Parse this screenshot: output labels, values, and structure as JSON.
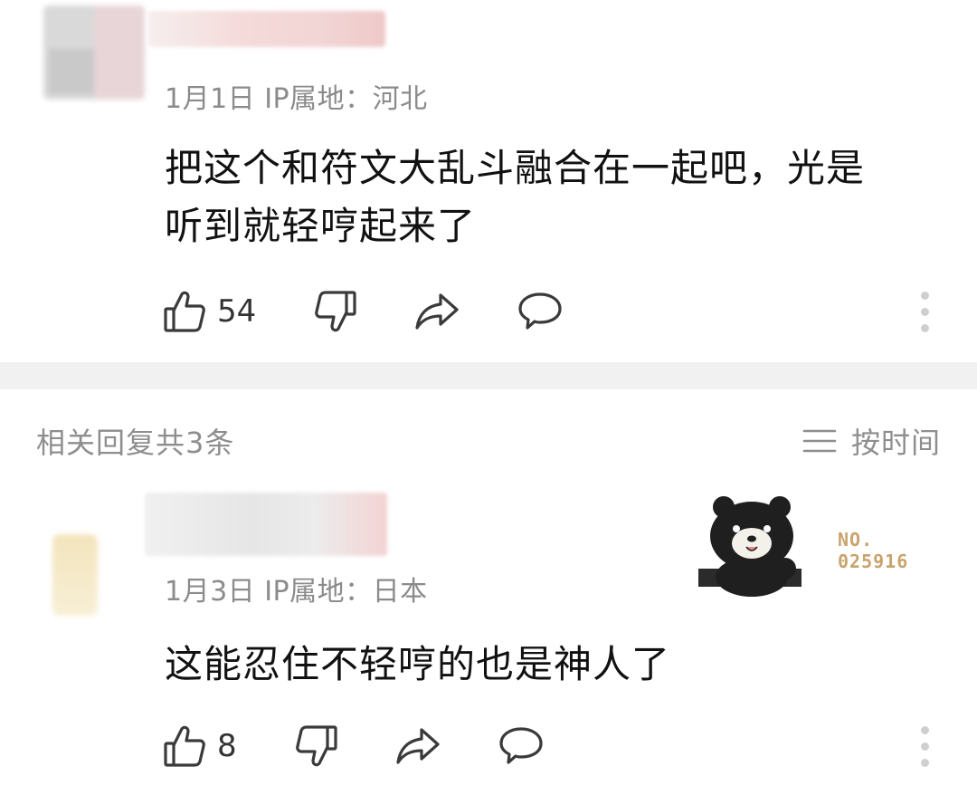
{
  "comments": [
    {
      "meta": "1月1日 IP属地：河北",
      "text_lines": [
        "把这个和符文大乱斗融合在一起吧，光是",
        "听到就轻哼起来了"
      ],
      "likes": "54"
    },
    {
      "meta": "1月3日 IP属地：日本",
      "text_lines": [
        "这能忍住不轻哼的也是神人了"
      ],
      "likes": "8",
      "badge": {
        "line1": "NO.",
        "line2": "025916"
      }
    }
  ],
  "related": {
    "title": "相关回复共3条",
    "sort_label": "按时间"
  },
  "icons": [
    "thumbs-up-icon",
    "thumbs-down-icon",
    "share-icon",
    "comment-icon",
    "more-icon",
    "sort-icon"
  ],
  "colors": {
    "meta": "#8b8b8b",
    "icon_stroke": "#3a3a3a",
    "divider": "#f1f1f1",
    "badge": "#c9a36d"
  }
}
